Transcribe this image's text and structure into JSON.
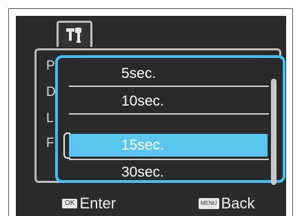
{
  "tab_icon": "wrench-tools-icon",
  "background_menu_initials": [
    "P",
    "D",
    "L",
    "F"
  ],
  "options": [
    {
      "label": "5sec.",
      "selected": false
    },
    {
      "label": "10sec.",
      "selected": false
    },
    {
      "label": "15sec.",
      "selected": true
    },
    {
      "label": "30sec.",
      "selected": false
    }
  ],
  "footer": {
    "enter_key": "OK",
    "enter_label": "Enter",
    "back_key": "MENU",
    "back_label": "Back"
  },
  "colors": {
    "accent": "#45c1ef",
    "selected_row": "#5bc7f0",
    "screen_bg": "#2b2b2b"
  }
}
